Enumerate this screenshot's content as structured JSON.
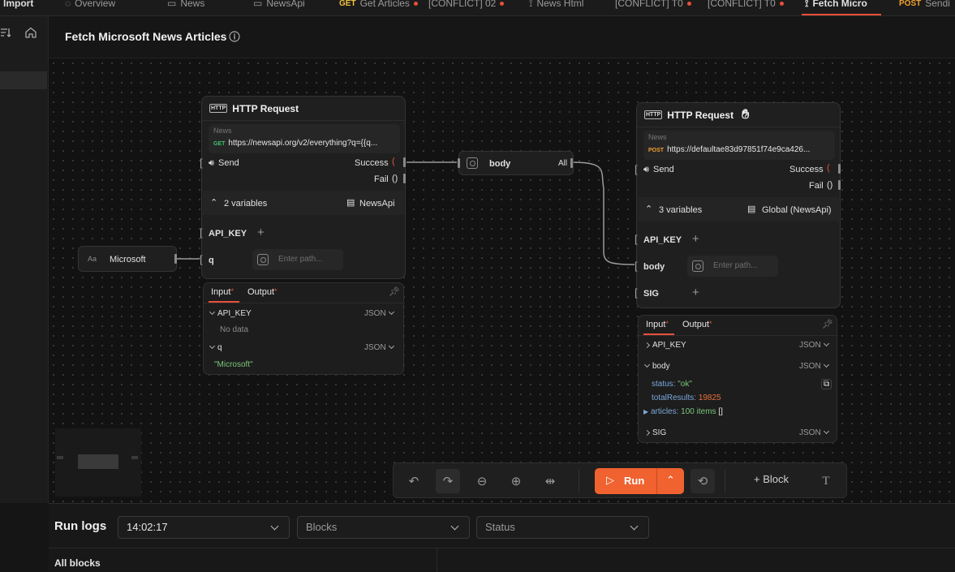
{
  "tabs": [
    {
      "label": "Import",
      "active": false
    },
    {
      "label": "Overview",
      "active": false
    },
    {
      "label": "News",
      "active": false
    },
    {
      "label": "NewsApi",
      "active": false
    },
    {
      "method": "GET",
      "label": "Get Articles",
      "active": false
    },
    {
      "label": "[CONFLICT] 02",
      "active": false
    },
    {
      "label": "News Html",
      "active": false
    },
    {
      "label": "[CONFLICT] T0",
      "active": false
    },
    {
      "label": "[CONFLICT] T0",
      "active": false
    },
    {
      "label": "Fetch Micro",
      "active": true
    },
    {
      "method": "POST",
      "label": "Sendi",
      "active": false
    }
  ],
  "header": {
    "title": "Fetch Microsoft News Articles"
  },
  "node_left": {
    "title": "HTTP Request",
    "url_label": "News",
    "method": "GET",
    "url": "https://newsapi.org/v2/everything?q={{q...",
    "send_label": "Send",
    "success_label": "Success",
    "fail_label": "Fail",
    "variables_count": "2 variables",
    "variables_source": "NewsApi",
    "vars": [
      {
        "name": "API_KEY"
      },
      {
        "name": "q",
        "placeholder": "Enter path..."
      }
    ],
    "panel": {
      "tab_input": "Input",
      "tab_output": "Output",
      "rows": [
        {
          "name": "API_KEY",
          "format": "JSON",
          "value": "No data"
        },
        {
          "name": "q",
          "format": "JSON",
          "value": "\"Microsoft\""
        }
      ]
    }
  },
  "text_node": {
    "badge": "Aa",
    "label": "Microsoft"
  },
  "body_node": {
    "label": "body",
    "right": "All"
  },
  "node_right": {
    "title": "HTTP Request",
    "url_label": "News",
    "method": "POST",
    "url": "https://defaultae83d97851f74e9ca426...",
    "send_label": "Send",
    "success_label": "Success",
    "fail_label": "Fail",
    "variables_count": "3 variables",
    "variables_source": "Global (NewsApi)",
    "vars": [
      {
        "name": "API_KEY"
      },
      {
        "name": "body",
        "placeholder": "Enter path..."
      },
      {
        "name": "SIG"
      }
    ],
    "panel": {
      "tab_input": "Input",
      "tab_output": "Output",
      "rows": [
        {
          "name": "API_KEY",
          "format": "JSON"
        },
        {
          "name": "body",
          "format": "JSON"
        },
        {
          "name": "SIG",
          "format": "JSON"
        }
      ],
      "body_fields": {
        "status_key": "status:",
        "status_val": "\"ok\"",
        "total_key": "totalResults:",
        "total_val": "19825",
        "articles_key": "articles:",
        "articles_val": "100 items",
        "articles_bracket": "[]"
      }
    }
  },
  "toolbar": {
    "run_label": "Run",
    "block_label": "Block"
  },
  "run_logs": {
    "title": "Run logs",
    "time_value": "14:02:17",
    "blocks_placeholder": "Blocks",
    "status_placeholder": "Status",
    "all_blocks_label": "All blocks"
  },
  "colors": {
    "accent": "#f0622f",
    "background": "#121212",
    "node": "#1f1f1f",
    "success_key": "#7aa7d8",
    "string": "#7ac77a",
    "number": "#e8703a"
  }
}
